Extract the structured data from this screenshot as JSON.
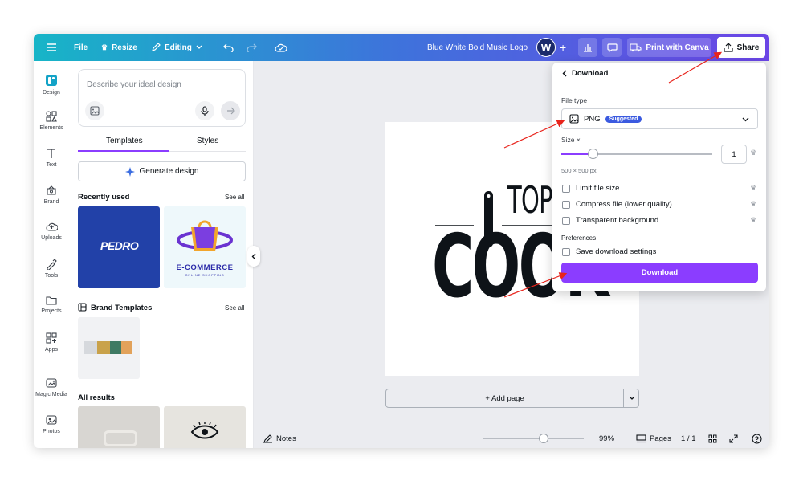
{
  "topbar": {
    "file_label": "File",
    "resize_label": "Resize",
    "editing_label": "Editing",
    "design_title": "Blue White Bold Music Logo",
    "avatar_initial": "W",
    "print_label": "Print with Canva",
    "share_label": "Share",
    "gradient": [
      "#17b5c7",
      "#3d74db",
      "#6b45e6"
    ]
  },
  "rail": {
    "items": [
      {
        "label": "Design",
        "icon": "design-icon"
      },
      {
        "label": "Elements",
        "icon": "elements-icon"
      },
      {
        "label": "Text",
        "icon": "text-icon"
      },
      {
        "label": "Brand",
        "icon": "brand-icon"
      },
      {
        "label": "Uploads",
        "icon": "uploads-icon"
      },
      {
        "label": "Tools",
        "icon": "tools-icon"
      },
      {
        "label": "Projects",
        "icon": "folder-icon"
      },
      {
        "label": "Apps",
        "icon": "apps-icon"
      },
      {
        "label": "Magic Media",
        "icon": "magic-media-icon"
      },
      {
        "label": "Photos",
        "icon": "photos-icon"
      }
    ]
  },
  "panel": {
    "prompt_placeholder": "Describe your ideal design",
    "tabs": [
      "Templates",
      "Styles"
    ],
    "generate_label": "Generate design",
    "recently_used": "Recently used",
    "see_all": "See all",
    "brand_templates": "Brand Templates",
    "all_results": "All results",
    "thumb_pedro": "PEDRO",
    "thumb_ecommerce": "E-COMMERCE",
    "thumb_ecommerce_sub": "ONLINE SHOPPING"
  },
  "canvas": {
    "logo_top": "TOP",
    "logo_main": "COOK",
    "add_page": "+ Add page"
  },
  "bottombar": {
    "notes": "Notes",
    "zoom": "99%",
    "pages": "Pages",
    "page_count": "1 / 1",
    "zoom_fraction": 0.6
  },
  "download": {
    "title": "Download",
    "file_type_label": "File type",
    "file_type": "PNG",
    "suggested": "Suggested",
    "size_label": "Size ×",
    "size_value": "1",
    "dimensions": "500 × 500 px",
    "options": [
      {
        "label": "Limit file size",
        "checked": false,
        "premium": true
      },
      {
        "label": "Compress file (lower quality)",
        "checked": false,
        "premium": true
      },
      {
        "label": "Transparent background",
        "checked": false,
        "premium": true
      }
    ],
    "preferences_label": "Preferences",
    "save_settings": "Save download settings",
    "download_button": "Download",
    "accent": "#8b3dff",
    "size_fraction": 0.21
  }
}
